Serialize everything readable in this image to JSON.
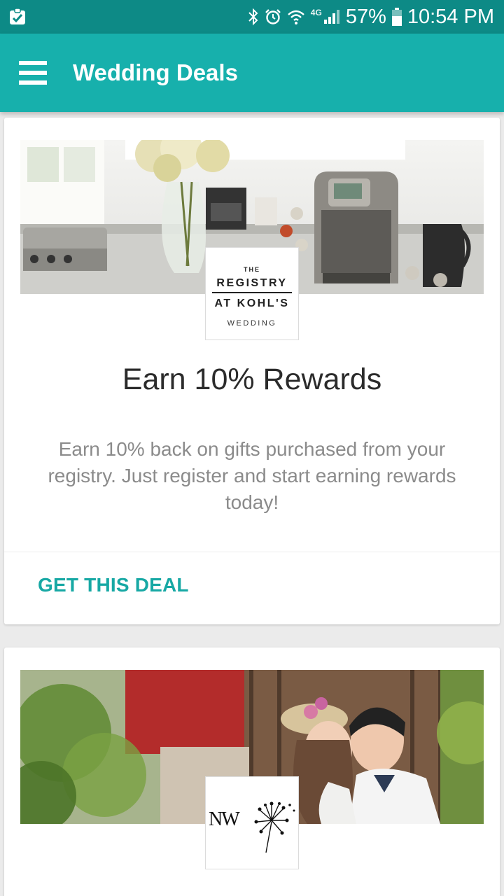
{
  "status_bar": {
    "network": "4G",
    "battery": "57%",
    "time": "10:54 PM"
  },
  "app_bar": {
    "title": "Wedding Deals"
  },
  "deals": [
    {
      "logo": {
        "line_top": "THE",
        "line_main_1": "REGISTRY",
        "line_main_2": "AT KOHL'S",
        "line_bottom": "WEDDING"
      },
      "title": "Earn 10% Rewards",
      "description": "Earn 10% back on gifts purchased from your registry. Just register and start earning rewards today!",
      "button_label": "GET THIS DEAL"
    },
    {
      "logo": {
        "text": "NW"
      }
    }
  ],
  "icons": {
    "status_left": "clipboard-check-icon",
    "status_right": [
      "bluetooth-icon",
      "alarm-icon",
      "wifi-icon",
      "signal-icon",
      "battery-icon"
    ],
    "menu": "hamburger-menu-icon"
  },
  "colors": {
    "status_bar": "#0d8a86",
    "app_bar": "#17b0ac",
    "accent": "#17a8a4",
    "background": "#ebebeb"
  }
}
